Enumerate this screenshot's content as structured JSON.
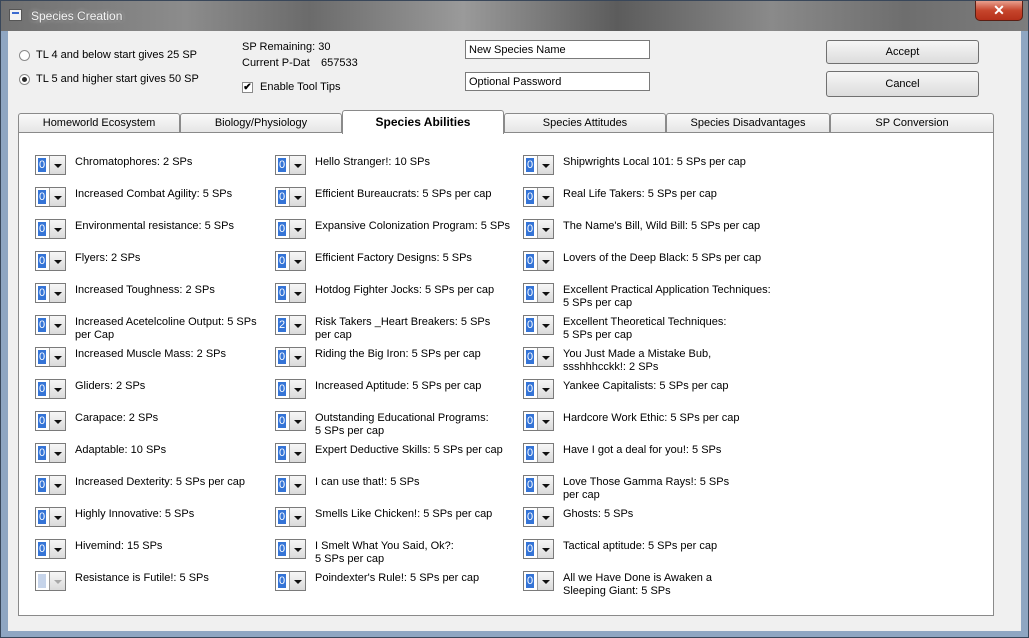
{
  "window": {
    "title": "Species Creation",
    "close_glyph": "✕"
  },
  "options": {
    "radio1": "TL 4 and below start gives 25 SP",
    "radio2": "TL 5 and higher start gives 50 SP",
    "selected": 2
  },
  "stats": {
    "sp_remaining": "SP Remaining: 30",
    "pdat_label": "Current P-Dat",
    "pdat_value": "657533",
    "tooltips_label": "Enable Tool Tips",
    "tooltips_checked": true
  },
  "fields": {
    "name_value": "New Species Name",
    "password_value": "Optional Password"
  },
  "buttons": {
    "accept": "Accept",
    "cancel": "Cancel"
  },
  "tabs": [
    {
      "label": "Homeworld Ecosystem",
      "active": false
    },
    {
      "label": "Biology/Physiology",
      "active": false
    },
    {
      "label": "Species Abilities",
      "active": true
    },
    {
      "label": "Species Attitudes",
      "active": false
    },
    {
      "label": "Species Disadvantages",
      "active": false
    },
    {
      "label": "SP Conversion",
      "active": false
    }
  ],
  "abilities": {
    "col1": [
      {
        "value": "0",
        "text": "Chromatophores: 2 SPs"
      },
      {
        "value": "0",
        "text": "Increased Combat Agility: 5 SPs"
      },
      {
        "value": "0",
        "text": "Environmental resistance: 5 SPs"
      },
      {
        "value": "0",
        "text": "Flyers: 2 SPs"
      },
      {
        "value": "0",
        "text": "Increased Toughness: 2 SPs"
      },
      {
        "value": "0",
        "text": "Increased Acetelcoline Output: 5 SPs\nper Cap"
      },
      {
        "value": "0",
        "text": "Increased Muscle Mass: 2 SPs"
      },
      {
        "value": "0",
        "text": "Gliders: 2 SPs"
      },
      {
        "value": "0",
        "text": "Carapace: 2 SPs"
      },
      {
        "value": "0",
        "text": "Adaptable: 10 SPs"
      },
      {
        "value": "0",
        "text": "Increased Dexterity: 5 SPs per cap"
      },
      {
        "value": "0",
        "text": "Highly Innovative: 5 SPs"
      },
      {
        "value": "0",
        "text": "Hivemind: 15 SPs"
      },
      {
        "value": "0",
        "text": "Resistance is Futile!: 5 SPs",
        "disabled": true
      }
    ],
    "col2": [
      {
        "value": "0",
        "text": "Hello Stranger!: 10 SPs"
      },
      {
        "value": "0",
        "text": "Efficient Bureaucrats: 5 SPs per cap"
      },
      {
        "value": "0",
        "text": "Expansive Colonization Program: 5 SPs"
      },
      {
        "value": "0",
        "text": "Efficient Factory Designs: 5 SPs"
      },
      {
        "value": "0",
        "text": "Hotdog Fighter Jocks: 5 SPs per cap"
      },
      {
        "value": "2",
        "text": "Risk Takers _Heart Breakers: 5 SPs\nper cap"
      },
      {
        "value": "0",
        "text": "Riding the Big Iron: 5 SPs per cap"
      },
      {
        "value": "0",
        "text": "Increased Aptitude: 5 SPs per cap"
      },
      {
        "value": "0",
        "text": "Outstanding Educational Programs:\n5 SPs per cap"
      },
      {
        "value": "0",
        "text": "Expert Deductive Skills: 5 SPs per cap"
      },
      {
        "value": "0",
        "text": "I can use that!: 5 SPs"
      },
      {
        "value": "0",
        "text": "Smells Like Chicken!: 5 SPs per cap"
      },
      {
        "value": "0",
        "text": "I Smelt What You Said, Ok?:\n5 SPs per cap"
      },
      {
        "value": "0",
        "text": "Poindexter's Rule!: 5 SPs per cap"
      }
    ],
    "col3": [
      {
        "value": "0",
        "text": "Shipwrights Local 101: 5 SPs per cap"
      },
      {
        "value": "0",
        "text": "Real Life Takers: 5 SPs per cap"
      },
      {
        "value": "0",
        "text": "The Name's Bill, Wild Bill: 5 SPs per cap"
      },
      {
        "value": "0",
        "text": "Lovers of the Deep Black: 5 SPs per cap"
      },
      {
        "value": "0",
        "text": "Excellent Practical Application Techniques:\n5 SPs per cap"
      },
      {
        "value": "0",
        "text": "Excellent Theoretical Techniques:\n5 SPs per cap"
      },
      {
        "value": "0",
        "text": "You Just Made a Mistake Bub,\nssshhhcckk!: 2 SPs"
      },
      {
        "value": "0",
        "text": "Yankee Capitalists: 5 SPs per cap"
      },
      {
        "value": "0",
        "text": "Hardcore Work Ethic: 5 SPs per cap"
      },
      {
        "value": "0",
        "text": "Have I got a deal for you!: 5 SPs"
      },
      {
        "value": "0",
        "text": "Love Those Gamma Rays!: 5 SPs\nper cap"
      },
      {
        "value": "0",
        "text": "Ghosts: 5 SPs"
      },
      {
        "value": "0",
        "text": "Tactical aptitude: 5 SPs per cap"
      },
      {
        "value": "0",
        "text": "All we Have Done is Awaken a\nSleeping Giant: 5 SPs"
      }
    ]
  }
}
